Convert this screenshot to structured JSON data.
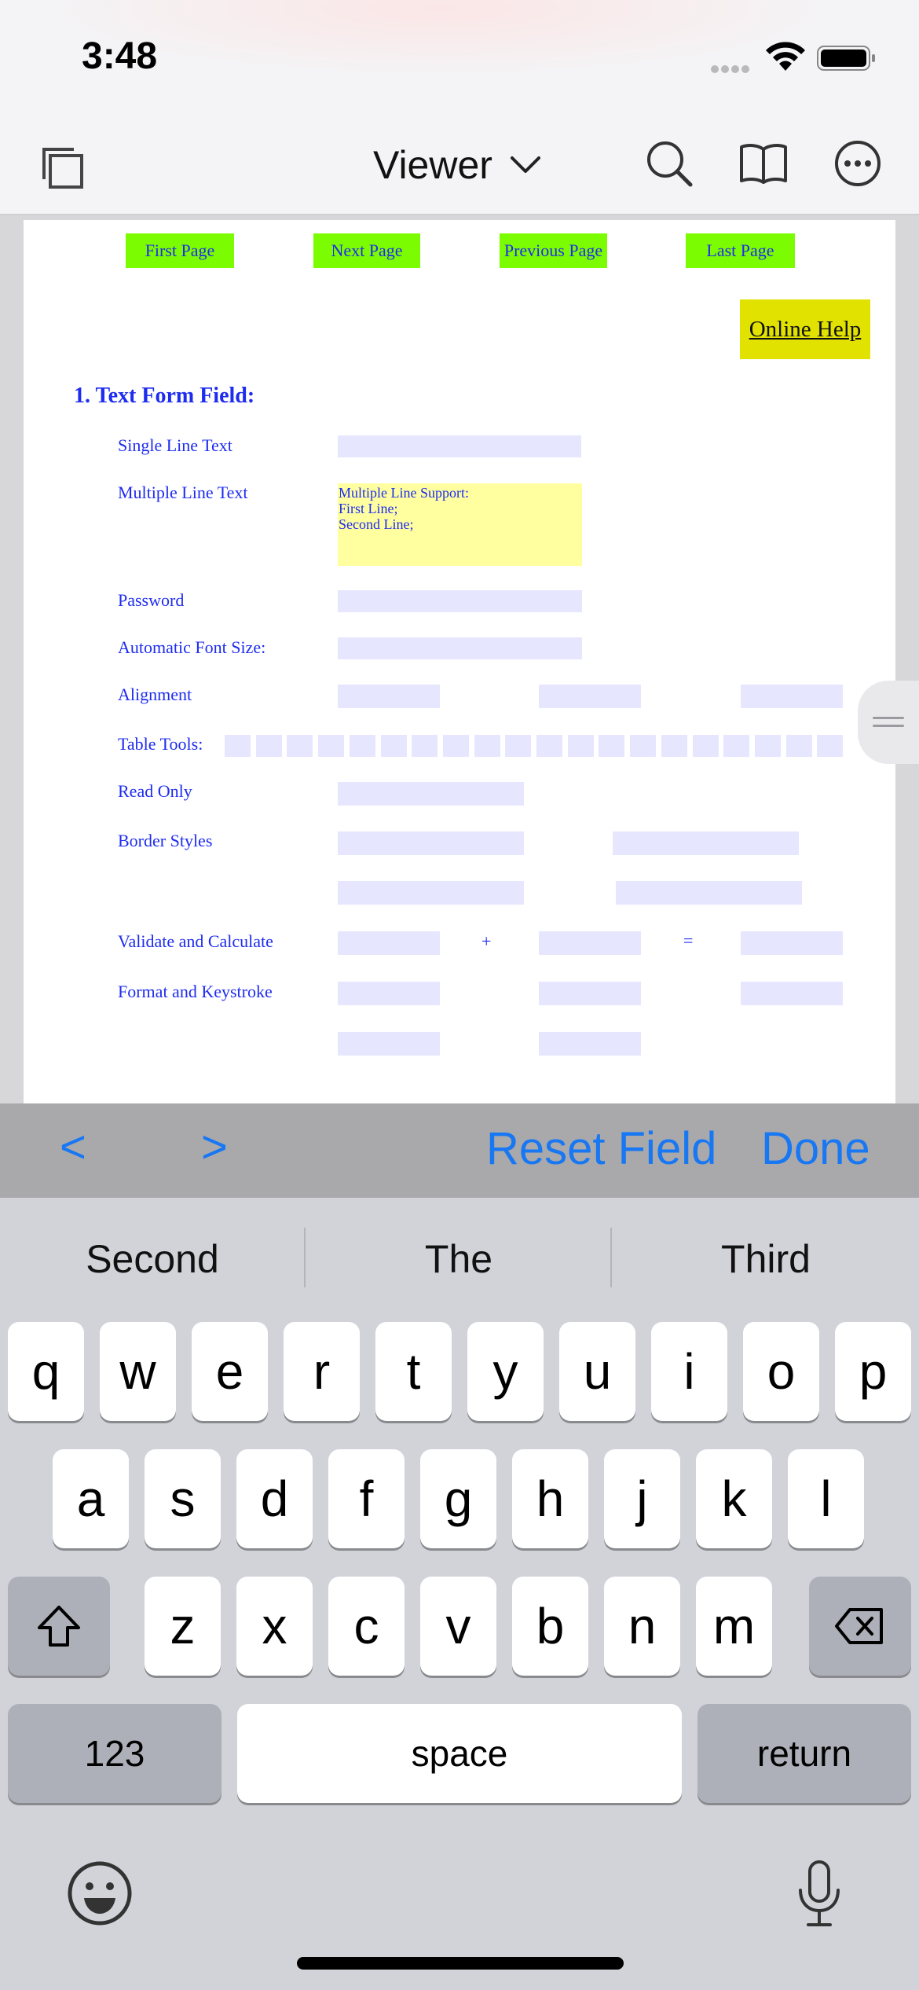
{
  "status": {
    "time": "3:48"
  },
  "nav": {
    "title": "Viewer"
  },
  "pdf": {
    "nav_buttons": [
      "First Page",
      "Next Page",
      "Previous Page",
      "Last Page"
    ],
    "online_help": "Online Help",
    "section_title": "1. Text Form Field:",
    "labels": {
      "single_line": "Single Line Text",
      "multiple_line": "Multiple Line Text",
      "password": "Password",
      "auto_font": "Automatic Font Size:",
      "alignment": "Alignment",
      "table_tools": "Table Tools:",
      "read_only": "Read Only",
      "border_styles": "Border Styles",
      "validate": "Validate and Calculate",
      "format": "Format and Keystroke"
    },
    "multiline_value": [
      "Multiple Line Support:",
      "First Line;",
      "Second Line;"
    ],
    "plus": "+",
    "equals": "="
  },
  "accessory": {
    "prev": "<",
    "next": ">",
    "reset": "Reset Field",
    "done": "Done"
  },
  "keyboard": {
    "suggestions": [
      "Second",
      "The",
      "Third"
    ],
    "row1": [
      "q",
      "w",
      "e",
      "r",
      "t",
      "y",
      "u",
      "i",
      "o",
      "p"
    ],
    "row2": [
      "a",
      "s",
      "d",
      "f",
      "g",
      "h",
      "j",
      "k",
      "l"
    ],
    "row3": [
      "z",
      "x",
      "c",
      "v",
      "b",
      "n",
      "m"
    ],
    "numbers": "123",
    "space": "space",
    "return": "return"
  }
}
